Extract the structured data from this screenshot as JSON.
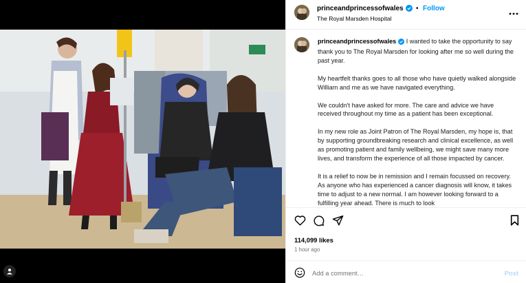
{
  "header": {
    "username": "princeandprincessofwales",
    "separator": "•",
    "follow_label": "Follow",
    "location": "The Royal Marsden Hospital",
    "more_label": "•••"
  },
  "caption": {
    "username": "princeandprincessofwales",
    "paragraphs": [
      "I wanted to take the opportunity to say thank you to The Royal Marsden for looking after me so well during the past year.",
      "My heartfelt thanks goes to all those who have quietly walked alongside William and me as we have navigated everything.",
      "We couldn't have asked for more. The care and advice we have received throughout my time as a patient has been exceptional.",
      "In my new role as Joint Patron of The Royal Marsden, my hope is, that by supporting groundbreaking research and clinical excellence, as well as promoting patient and family wellbeing, we might save many more lives, and transform the experience of all those impacted by cancer.",
      "It is a relief to now be in remission and I remain focussed on recovery. As anyone who has experienced a cancer diagnosis will know, it takes time to adjust to a new normal. I am however looking forward to a fulfilling year ahead. There is much to look"
    ]
  },
  "engagement": {
    "likes": "114,099 likes",
    "time": "1 hour ago"
  },
  "comment": {
    "placeholder": "Add a comment…",
    "post_label": "Post"
  },
  "colors": {
    "accent": "#0095f6",
    "post_disabled": "#b3dbff",
    "muted": "#737373"
  },
  "icons": [
    "verified-badge-icon",
    "more-options-icon",
    "heart-icon",
    "comment-icon",
    "share-icon",
    "bookmark-icon",
    "emoji-icon",
    "user-tag-icon"
  ]
}
